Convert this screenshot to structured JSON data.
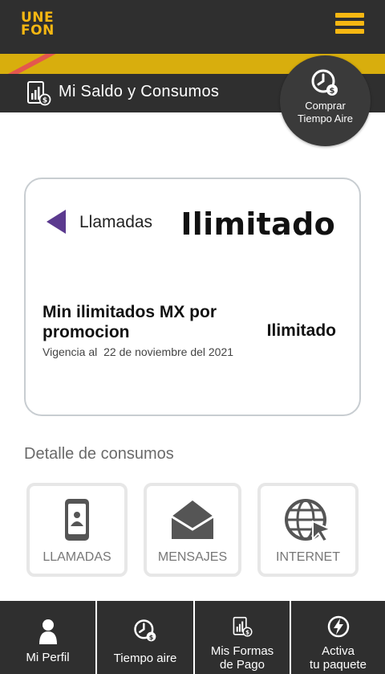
{
  "header": {
    "logo_line1": "UNE",
    "logo_line2": "FON",
    "menu_icon": "hamburger-menu-icon"
  },
  "colors": {
    "brand_yellow": "#f6b712",
    "stripe_yellow": "#d8ae0d",
    "stripe_red": "#e4574e",
    "dark_bar": "#2f2f2f",
    "accent_purple": "#5b3a8f"
  },
  "section": {
    "title": "Mi Saldo y Consumos",
    "icon": "saldo-chart-icon"
  },
  "buy_button": {
    "line1": "Comprar",
    "line2": "Tiempo Aire",
    "icon": "clock-money-icon"
  },
  "card": {
    "category": "Llamadas",
    "status_big": "Ilimitado",
    "promo_name": "Min ilimitados MX por promocion",
    "promo_value": "Ilimitado",
    "valid_label": "Vigencia al",
    "valid_date": "22 de noviembre del 2021"
  },
  "detail": {
    "title": "Detalle de consumos",
    "tiles": [
      {
        "label": "LLAMADAS",
        "icon": "phone-icon"
      },
      {
        "label": "MENSAJES",
        "icon": "envelope-icon"
      },
      {
        "label": "INTERNET",
        "icon": "globe-icon"
      }
    ]
  },
  "bottom_nav": [
    {
      "label": "Mi Perfil",
      "icon": "user-icon"
    },
    {
      "label": "Tiempo aire",
      "icon": "clock-money-icon"
    },
    {
      "label_line1": "Mis Formas",
      "label_line2": "de Pago",
      "icon": "payment-chart-icon"
    },
    {
      "label_line1": "Activa",
      "label_line2": "tu paquete",
      "icon": "lightning-icon"
    }
  ]
}
